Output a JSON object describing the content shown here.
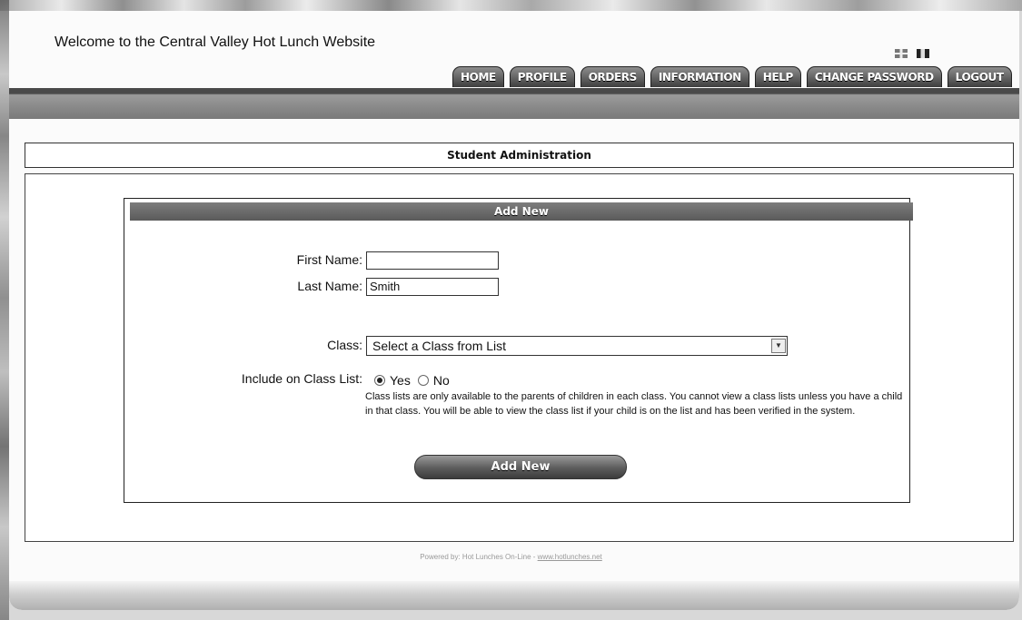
{
  "site": {
    "welcome": "Welcome to the Central Valley Hot Lunch Website"
  },
  "nav": {
    "tabs": [
      {
        "label": "HOME"
      },
      {
        "label": "PROFILE"
      },
      {
        "label": "ORDERS"
      },
      {
        "label": "INFORMATION"
      },
      {
        "label": "HELP"
      },
      {
        "label": "CHANGE PASSWORD"
      },
      {
        "label": "LOGOUT"
      }
    ]
  },
  "languages": [
    "english-flag",
    "french-flag"
  ],
  "section": {
    "title": "Student Administration"
  },
  "form": {
    "header": "Add New",
    "first_name_label": "First Name:",
    "first_name_value": "",
    "last_name_label": "Last Name:",
    "last_name_value": "Smith",
    "class_label": "Class:",
    "class_selected": "Select a Class from List",
    "include_label": "Include on Class List:",
    "radio_yes": "Yes",
    "radio_no": "No",
    "include_selected": "Yes",
    "note": "Class lists are only available to the parents of children in each class. You cannot view a class lists unless you have a child in that class. You will be able to view the class list if your child is on the list and has been verified in the system.",
    "submit_label": "Add New"
  },
  "footer": {
    "prefix": "Powered by: Hot Lunches On-Line - ",
    "link": "www.hotlunches.net"
  }
}
